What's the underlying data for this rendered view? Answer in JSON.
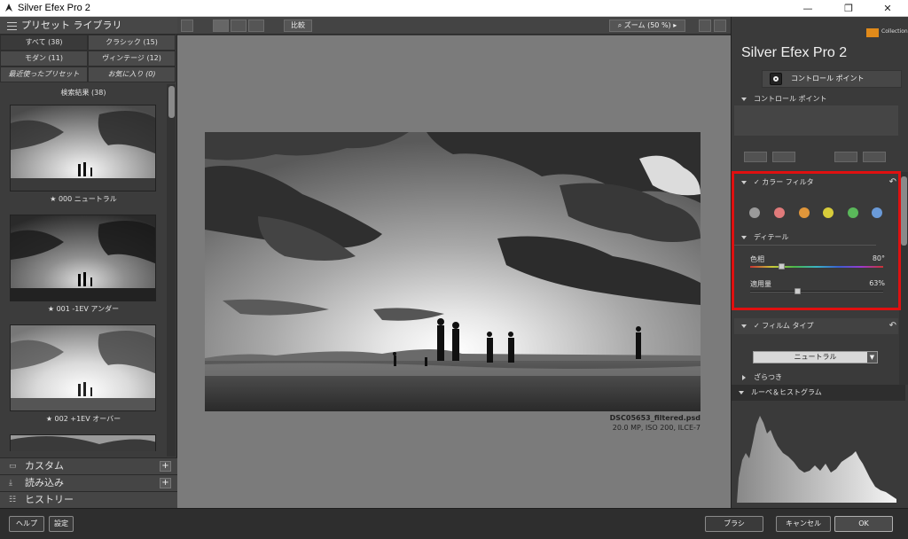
{
  "window": {
    "title": "Silver Efex Pro 2",
    "minimize": "—",
    "maximize": "❐",
    "close": "✕"
  },
  "left_panel": {
    "header": "プリセット ライブラリ",
    "categories": [
      {
        "label": "すべて (38)"
      },
      {
        "label": "クラシック (15)"
      },
      {
        "label": "モダン (11)"
      },
      {
        "label": "ヴィンテージ (12)"
      },
      {
        "label": "最近使ったプリセット"
      },
      {
        "label": "お気に入り (0)"
      }
    ],
    "results_label": "検索結果 (38)",
    "presets": [
      {
        "label": "★ 000 ニュートラル"
      },
      {
        "label": "★ 001 -1EV アンダー"
      },
      {
        "label": "★ 002 +1EV オーバー"
      }
    ],
    "sections": [
      {
        "label": "カスタム",
        "icon": "folder-icon"
      },
      {
        "label": "読み込み",
        "icon": "import-icon"
      },
      {
        "label": "ヒストリー",
        "icon": "history-icon"
      }
    ],
    "add_symbol": "+"
  },
  "toolbar": {
    "compare_label": "比較",
    "zoom_label": "ズーム (50 %)"
  },
  "image": {
    "filename": "DSC05653_filtered.psd",
    "info": "20.0 MP, ISO 200, ILCE-7"
  },
  "right_panel": {
    "brand": "Silver Efex Pro 2",
    "badge": "Collection",
    "control_point_button": "コントロール ポイント",
    "control_point_section": "コントロール ポイント",
    "color_filter_section": "カラー フィルタ",
    "color_filter_check": "✓",
    "filter_colors": [
      "#9a9a9a",
      "#e07a7a",
      "#e0963a",
      "#d8cc3a",
      "#5ab85a",
      "#6a9ad8"
    ],
    "detail_label": "ディテール",
    "hue_label": "色相",
    "hue_value": "80°",
    "strength_label": "適用量",
    "strength_value": "63%",
    "film_type_section": "フィルム タイプ",
    "film_select_value": "ニュートラル",
    "grain_label": "ざらつき",
    "histogram_section": "ルーペ＆ヒストグラム",
    "undo_symbol": "↶"
  },
  "bottom_bar": {
    "help": "ヘルプ",
    "settings": "設定",
    "brush": "ブラシ",
    "cancel": "キャンセル",
    "ok": "OK"
  }
}
